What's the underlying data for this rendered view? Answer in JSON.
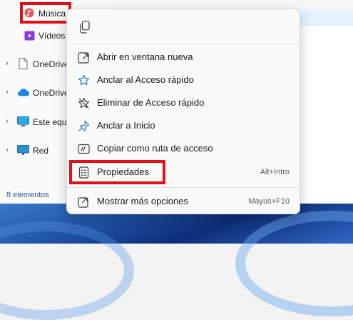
{
  "nav": {
    "items": [
      {
        "label": "Música",
        "icon": "music-icon",
        "expandable": false
      },
      {
        "label": "Vídeos",
        "icon": "video-icon",
        "expandable": false
      },
      {
        "label": "OneDrive",
        "icon": "document-icon",
        "expandable": true
      },
      {
        "label": "OneDrive",
        "icon": "cloud-icon",
        "expandable": true
      },
      {
        "label": "Este equi",
        "icon": "computer-icon",
        "expandable": true
      },
      {
        "label": "Red",
        "icon": "network-icon",
        "expandable": true
      }
    ],
    "chevron": "›"
  },
  "status_bar": {
    "item_count": "8 elementos"
  },
  "context_menu": {
    "top_icon": "copy-icon",
    "items": [
      {
        "label": "Abrir en ventana nueva",
        "icon": "open-new-window-icon",
        "shortcut": ""
      },
      {
        "label": "Anclar al Acceso rápido",
        "icon": "star-icon",
        "shortcut": ""
      },
      {
        "label": "Eliminar de Acceso rápido",
        "icon": "unstar-icon",
        "shortcut": ""
      },
      {
        "label": "Anclar a Inicio",
        "icon": "pin-icon",
        "shortcut": ""
      },
      {
        "label": "Copiar como ruta de acceso",
        "icon": "copy-path-icon",
        "shortcut": ""
      },
      {
        "label": "Propiedades",
        "icon": "properties-icon",
        "shortcut": "Alt+Intro"
      },
      {
        "label": "Mostrar más opciones",
        "icon": "more-options-icon",
        "shortcut": "Mayús+F10"
      }
    ]
  },
  "colors": {
    "highlight": "#e0101a",
    "accent": "#0067c0",
    "menu_bg": "#f9f9f9"
  }
}
